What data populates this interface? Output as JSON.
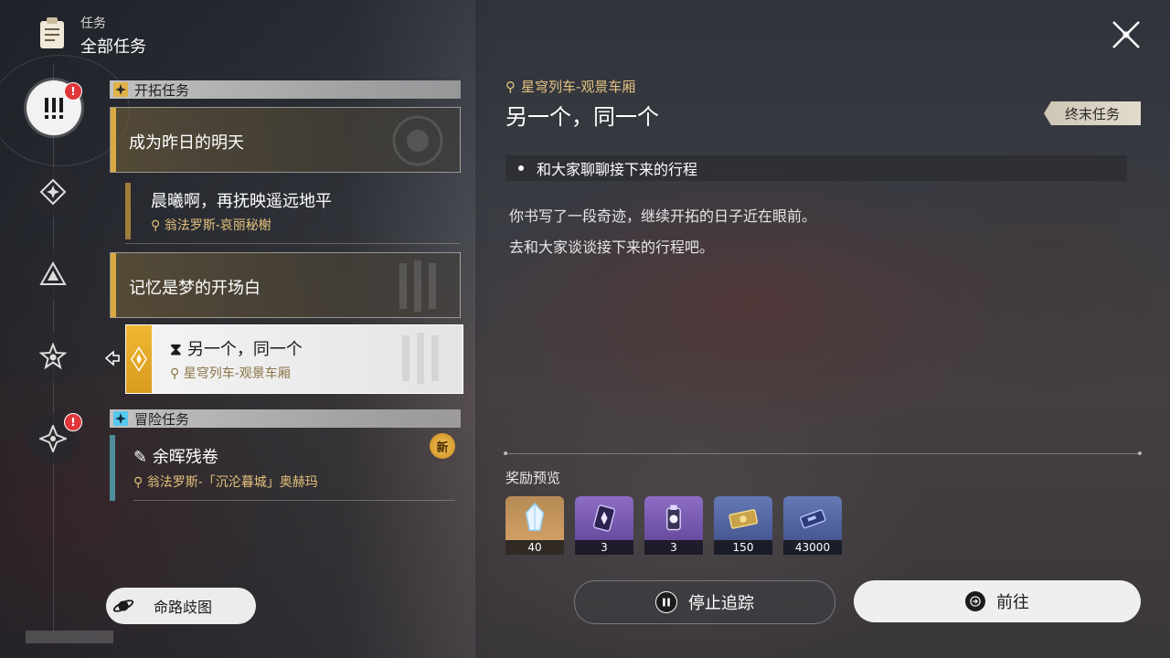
{
  "header": {
    "category": "任务",
    "title": "全部任务"
  },
  "rail": {
    "items": [
      {
        "name": "all",
        "badge": "!"
      },
      {
        "name": "trailblaze",
        "badge": ""
      },
      {
        "name": "companion",
        "badge": ""
      },
      {
        "name": "adventure",
        "badge": ""
      },
      {
        "name": "daily",
        "badge": "!"
      }
    ]
  },
  "sections": {
    "trailblaze": "开拓任务",
    "adventure": "冒险任务"
  },
  "quests": {
    "parent1": {
      "title": "成为昨日的明天"
    },
    "child1": {
      "title": "晨曦啊，再抚映遥远地平",
      "location": "翁法罗斯-哀丽秘榭"
    },
    "parent2": {
      "title": "记忆是梦的开场白"
    },
    "selected": {
      "title": "另一个，同一个",
      "location": "星穹列车-观景车厢"
    },
    "adventure1": {
      "title": "余晖残卷",
      "location": "翁法罗斯-「沉沦暮城」奥赫玛",
      "new_badge": "新"
    }
  },
  "path_button": "命路歧图",
  "detail": {
    "location": "星穹列车-观景车厢",
    "title": "另一个，同一个",
    "tag": "终末任务",
    "objective": "和大家聊聊接下来的行程",
    "desc_line1": "你书写了一段奇迹，继续开拓的日子近在眼前。",
    "desc_line2": "去和大家谈谈接下来的行程吧。",
    "rewards_label": "奖励预览",
    "rewards": [
      {
        "icon": "stellar-jade-icon",
        "count": "40"
      },
      {
        "icon": "lost-crystal-icon",
        "count": "3"
      },
      {
        "icon": "refined-aether-icon",
        "count": "3"
      },
      {
        "icon": "credit-bill-icon",
        "count": "150"
      },
      {
        "icon": "ticket-icon",
        "count": "43000"
      }
    ]
  },
  "buttons": {
    "stop": "停止追踪",
    "go": "前往"
  },
  "colors": {
    "gold": "#d9a941",
    "location": "#e5c17c",
    "cyan": "#55c8ec",
    "badge_red": "#e0373b"
  }
}
